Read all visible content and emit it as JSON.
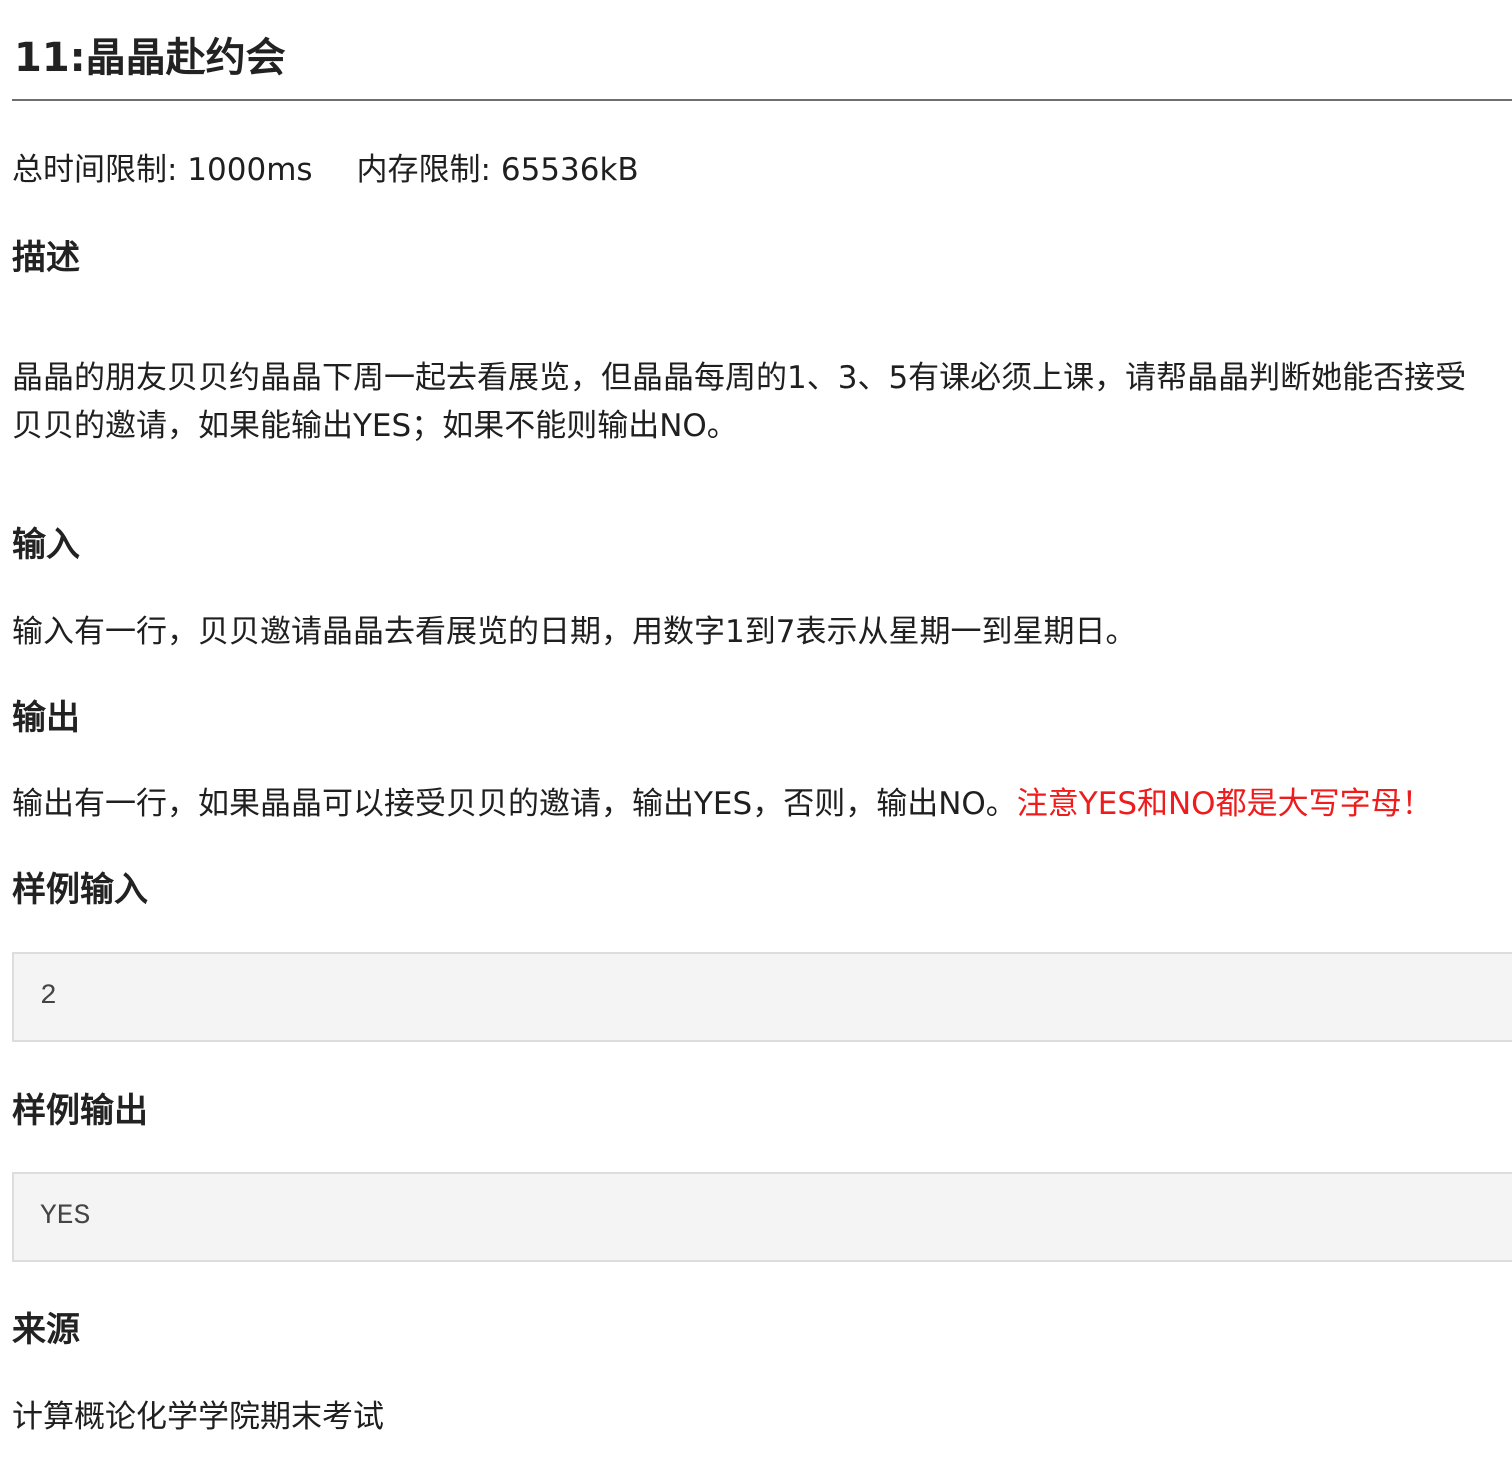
{
  "problem": {
    "title": "11:晶晶赴约会",
    "time_limit": "总时间限制: 1000ms",
    "memory_limit": "内存限制: 65536kB"
  },
  "sections": {
    "description": {
      "heading": "描述",
      "line1": "晶晶的朋友贝贝约晶晶下周一起去看展览，但晶晶每周的1、3、5有课必须上课，请帮晶晶判断她能否接受",
      "line2": "贝贝的邀请，如果能输出YES；如果不能则输出NO。"
    },
    "input": {
      "heading": "输入",
      "text": "输入有一行，贝贝邀请晶晶去看展览的日期，用数字1到7表示从星期一到星期日。"
    },
    "output": {
      "heading": "输出",
      "text": "输出有一行，如果晶晶可以接受贝贝的邀请，输出YES，否则，输出NO。",
      "note": "注意YES和NO都是大写字母！"
    },
    "sample_input": {
      "heading": "样例输入",
      "value": "2"
    },
    "sample_output": {
      "heading": "样例输出",
      "value": "YES"
    },
    "source": {
      "heading": "来源",
      "text": "计算概论化学学院期末考试"
    }
  },
  "colors": {
    "note": "#ee1c1c",
    "sample_bg": "#f4f4f4",
    "sample_border": "#dddddd",
    "rule": "#6f6f6f"
  }
}
